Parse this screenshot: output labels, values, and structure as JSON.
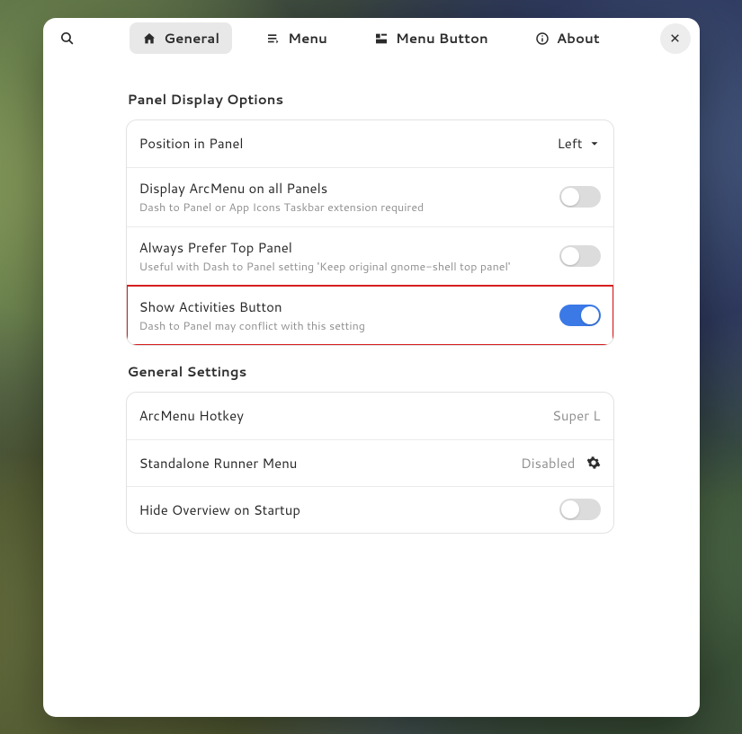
{
  "tabs": {
    "general": "General",
    "menu": "Menu",
    "menu_button": "Menu Button",
    "about": "About"
  },
  "panel": {
    "section": "Panel Display Options",
    "position": {
      "label": "Position in Panel",
      "value": "Left"
    },
    "all_panels": {
      "label": "Display ArcMenu on all Panels",
      "sub": "Dash to Panel or App Icons Taskbar extension required"
    },
    "prefer_top": {
      "label": "Always Prefer Top Panel",
      "sub": "Useful with Dash to Panel setting 'Keep original gnome-shell top panel'"
    },
    "activities": {
      "label": "Show Activities Button",
      "sub": "Dash to Panel may conflict with this setting"
    }
  },
  "general": {
    "section": "General Settings",
    "hotkey": {
      "label": "ArcMenu Hotkey",
      "value": "Super L"
    },
    "runner": {
      "label": "Standalone Runner Menu",
      "value": "Disabled"
    },
    "hide_overview": {
      "label": "Hide Overview on Startup"
    }
  }
}
